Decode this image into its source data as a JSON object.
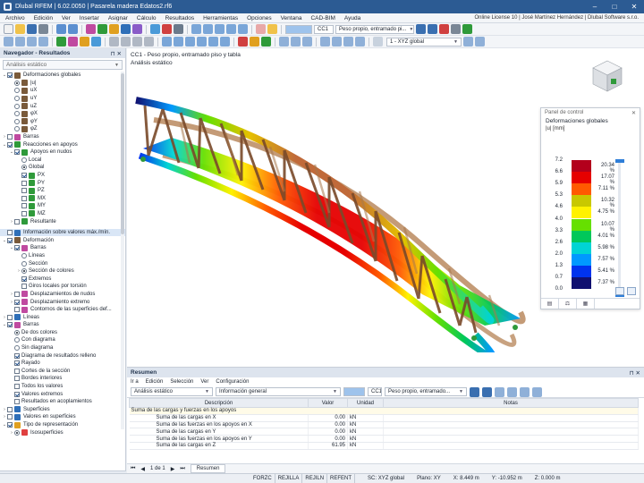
{
  "window": {
    "title": "Dlubal RFEM | 6.02.0050 | Pasarela madera Edatos2.rf6",
    "minimize": "–",
    "maximize": "□",
    "close": "✕"
  },
  "menu": [
    "Archivo",
    "Edición",
    "Ver",
    "Insertar",
    "Asignar",
    "Cálculo",
    "Resultados",
    "Herramientas",
    "Opciones",
    "Ventana",
    "CAD-BIM",
    "Ayuda"
  ],
  "license": "Online License 10 | José Martínez Hernández | Dlubal Software s.r.o.",
  "toolbar": {
    "load_case_id": "CC1",
    "load_case_name": "Peso propio, entramado pi...",
    "coord_system": "1 - XYZ global"
  },
  "navigator": {
    "title": "Navegador - Resultados",
    "combo": "Análisis estático",
    "items": [
      {
        "label": "Deformaciones globales",
        "level": 0,
        "exp": "⌄",
        "ctl": "cb",
        "on": true,
        "icon": "#7a5a3a"
      },
      {
        "label": "|u|",
        "level": 1,
        "ctl": "rb",
        "on": true,
        "icon": "#7a5a3a"
      },
      {
        "label": "uX",
        "level": 1,
        "ctl": "rb",
        "on": false,
        "icon": "#7a5a3a"
      },
      {
        "label": "uY",
        "level": 1,
        "ctl": "rb",
        "on": false,
        "icon": "#7a5a3a"
      },
      {
        "label": "uZ",
        "level": 1,
        "ctl": "rb",
        "on": false,
        "icon": "#7a5a3a"
      },
      {
        "label": "φX",
        "level": 1,
        "ctl": "rb",
        "on": false,
        "icon": "#7a5a3a"
      },
      {
        "label": "φY",
        "level": 1,
        "ctl": "rb",
        "on": false,
        "icon": "#7a5a3a"
      },
      {
        "label": "φZ",
        "level": 1,
        "ctl": "rb",
        "on": false,
        "icon": "#7a5a3a"
      },
      {
        "label": "Barras",
        "level": 0,
        "exp": "›",
        "ctl": "cb",
        "on": false,
        "icon": "#c04aa0"
      },
      {
        "label": "Reacciones en apoyos",
        "level": 0,
        "exp": "⌄",
        "ctl": "cb",
        "on": true,
        "icon": "#2f9a3a"
      },
      {
        "label": "Apoyos en nudos",
        "level": 1,
        "exp": "⌄",
        "ctl": "cb",
        "on": true,
        "icon": "#2f9a3a"
      },
      {
        "label": "Local",
        "level": 2,
        "ctl": "rb",
        "on": false,
        "icon": ""
      },
      {
        "label": "Global",
        "level": 2,
        "ctl": "rb",
        "on": true,
        "icon": ""
      },
      {
        "label": "PX",
        "level": 2,
        "ctl": "cb",
        "on": true,
        "icon": "#2f9a3a"
      },
      {
        "label": "PY",
        "level": 2,
        "ctl": "cb",
        "on": false,
        "icon": "#2f9a3a"
      },
      {
        "label": "PZ",
        "level": 2,
        "ctl": "cb",
        "on": false,
        "icon": "#2f9a3a"
      },
      {
        "label": "MX",
        "level": 2,
        "ctl": "cb",
        "on": false,
        "icon": "#2f9a3a"
      },
      {
        "label": "MY",
        "level": 2,
        "ctl": "cb",
        "on": false,
        "icon": "#2f9a3a"
      },
      {
        "label": "MZ",
        "level": 2,
        "ctl": "cb",
        "on": false,
        "icon": "#2f9a3a"
      },
      {
        "label": "Resultante",
        "level": 1,
        "exp": "›",
        "ctl": "cb",
        "on": false,
        "icon": "#2f9a3a"
      }
    ],
    "items2": [
      {
        "label": "Información sobre valores máx./mín.",
        "level": 0,
        "ctl": "cb",
        "on": false,
        "icon": "#2f6fb8",
        "hl": true
      },
      {
        "label": "Deformación",
        "level": 0,
        "exp": "⌄",
        "ctl": "cb",
        "on": true,
        "icon": "#7a5a3a"
      },
      {
        "label": "Barras",
        "level": 1,
        "exp": "⌄",
        "ctl": "cb",
        "on": true,
        "icon": "#c04aa0"
      },
      {
        "label": "Líneas",
        "level": 2,
        "ctl": "rb",
        "on": false,
        "icon": ""
      },
      {
        "label": "Sección",
        "level": 2,
        "ctl": "rb",
        "on": false,
        "icon": ""
      },
      {
        "label": "Sección de colores",
        "level": 2,
        "exp": "›",
        "ctl": "rb",
        "on": true,
        "icon": ""
      },
      {
        "label": "Extremos",
        "level": 2,
        "ctl": "cb",
        "on": true,
        "icon": ""
      },
      {
        "label": "Giros locales por torsión",
        "level": 2,
        "ctl": "cb",
        "on": false,
        "icon": ""
      },
      {
        "label": "Desplazamientos de nudos",
        "level": 1,
        "exp": "›",
        "ctl": "cb",
        "on": false,
        "icon": "#c04aa0"
      },
      {
        "label": "Desplazamiento extremo",
        "level": 1,
        "exp": "›",
        "ctl": "cb",
        "on": true,
        "icon": "#c04aa0"
      },
      {
        "label": "Contornos de las superficies def...",
        "level": 1,
        "ctl": "cb",
        "on": false,
        "icon": "#c04aa0"
      },
      {
        "label": "Líneas",
        "level": 0,
        "exp": "›",
        "ctl": "cb",
        "on": false,
        "icon": "#2f6fb8"
      },
      {
        "label": "Barras",
        "level": 0,
        "exp": "⌄",
        "ctl": "cb",
        "on": true,
        "icon": "#c04aa0"
      },
      {
        "label": "De dos colores",
        "level": 1,
        "ctl": "rb",
        "on": true,
        "icon": ""
      },
      {
        "label": "Con diagrama",
        "level": 1,
        "ctl": "rb",
        "on": false,
        "icon": ""
      },
      {
        "label": "Sin diagrama",
        "level": 1,
        "ctl": "rb",
        "on": false,
        "icon": ""
      },
      {
        "label": "Diagrama de resultados relleno",
        "level": 1,
        "ctl": "cb",
        "on": true,
        "icon": ""
      },
      {
        "label": "Rayado",
        "level": 1,
        "ctl": "cb",
        "on": true,
        "icon": ""
      },
      {
        "label": "Cortes de la sección",
        "level": 1,
        "ctl": "cb",
        "on": false,
        "icon": ""
      },
      {
        "label": "Bordes interiores",
        "level": 1,
        "ctl": "cb",
        "on": false,
        "icon": ""
      },
      {
        "label": "Todos los valores",
        "level": 1,
        "ctl": "cb",
        "on": false,
        "icon": ""
      },
      {
        "label": "Valores extremos",
        "level": 1,
        "ctl": "cb",
        "on": true,
        "icon": ""
      },
      {
        "label": "Resultados en acoplamientos",
        "level": 1,
        "ctl": "cb",
        "on": false,
        "icon": ""
      },
      {
        "label": "Superficies",
        "level": 0,
        "exp": "›",
        "ctl": "cb",
        "on": false,
        "icon": "#2f6fb8"
      },
      {
        "label": "Valores en superficies",
        "level": 0,
        "exp": "›",
        "ctl": "cb",
        "on": false,
        "icon": "#2f6fb8"
      },
      {
        "label": "Tipo de representación",
        "level": 0,
        "exp": "⌄",
        "ctl": "cb",
        "on": true,
        "icon": "#e0a020"
      },
      {
        "label": "Isosuperficies",
        "level": 1,
        "exp": "›",
        "ctl": "rb",
        "on": true,
        "icon": "#e04040"
      }
    ]
  },
  "viewport": {
    "line1": "CC1 - Peso propio, entramado piso y tabla",
    "line2": "Análisis estático"
  },
  "control_panel": {
    "title": "Panel de control",
    "close": "✕",
    "quantity": "Deformaciones globales",
    "unit": "|u| [mm]",
    "levels": [
      "7.2",
      "6.6",
      "5.9",
      "5.3",
      "4.6",
      "4.0",
      "3.3",
      "2.6",
      "2.0",
      "1.3",
      "0.7",
      "0.0"
    ],
    "percentages": [
      "20.34 %",
      "17.07 %",
      "7.11 %",
      "10.32 %",
      "4.75 %",
      "10.07 %",
      "4.01 %",
      "5.98 %",
      "7.57 %",
      "5.41 %",
      "7.37 %"
    ],
    "colors": [
      "#b3001c",
      "#e60000",
      "#ff5a00",
      "#c8c800",
      "#fff200",
      "#66e000",
      "#00c85a",
      "#00d4d4",
      "#0099ff",
      "#0033ee",
      "#101070"
    ]
  },
  "summary": {
    "title": "Resumen",
    "menu": [
      "Ir a",
      "Edición",
      "Selección",
      "Ver",
      "Configuración"
    ],
    "analysis_combo": "Análisis estático",
    "info_combo": "Información general",
    "lc_id": "CC1",
    "lc_name": "Peso propio, entramado...",
    "headers": [
      "Descripción",
      "Valor",
      "Unidad",
      "Notas"
    ],
    "group": "Suma de las cargas y fuerzas en los apoyos",
    "rows": [
      {
        "desc": "Suma de las cargas en X",
        "value": "0.00",
        "unit": "kN"
      },
      {
        "desc": "Suma de las fuerzas en los apoyos en X",
        "value": "0.00",
        "unit": "kN"
      },
      {
        "desc": "Suma de las cargas en Y",
        "value": "0.00",
        "unit": "kN"
      },
      {
        "desc": "Suma de las fuerzas en los apoyos en Y",
        "value": "0.00",
        "unit": "kN"
      },
      {
        "desc": "Suma de las cargas en Z",
        "value": "61.95",
        "unit": "kN"
      }
    ],
    "pager": "1 de 1",
    "tab": "Resumen"
  },
  "status": {
    "buttons": [
      "FORZC",
      "REJILLA",
      "REJILN",
      "REFENT"
    ],
    "cs": "SC: XYZ global",
    "plane": "Plano: XY",
    "x": "X: 8.449 m",
    "y": "Y: -10.952 m",
    "z": "Z: 0.000 m"
  }
}
